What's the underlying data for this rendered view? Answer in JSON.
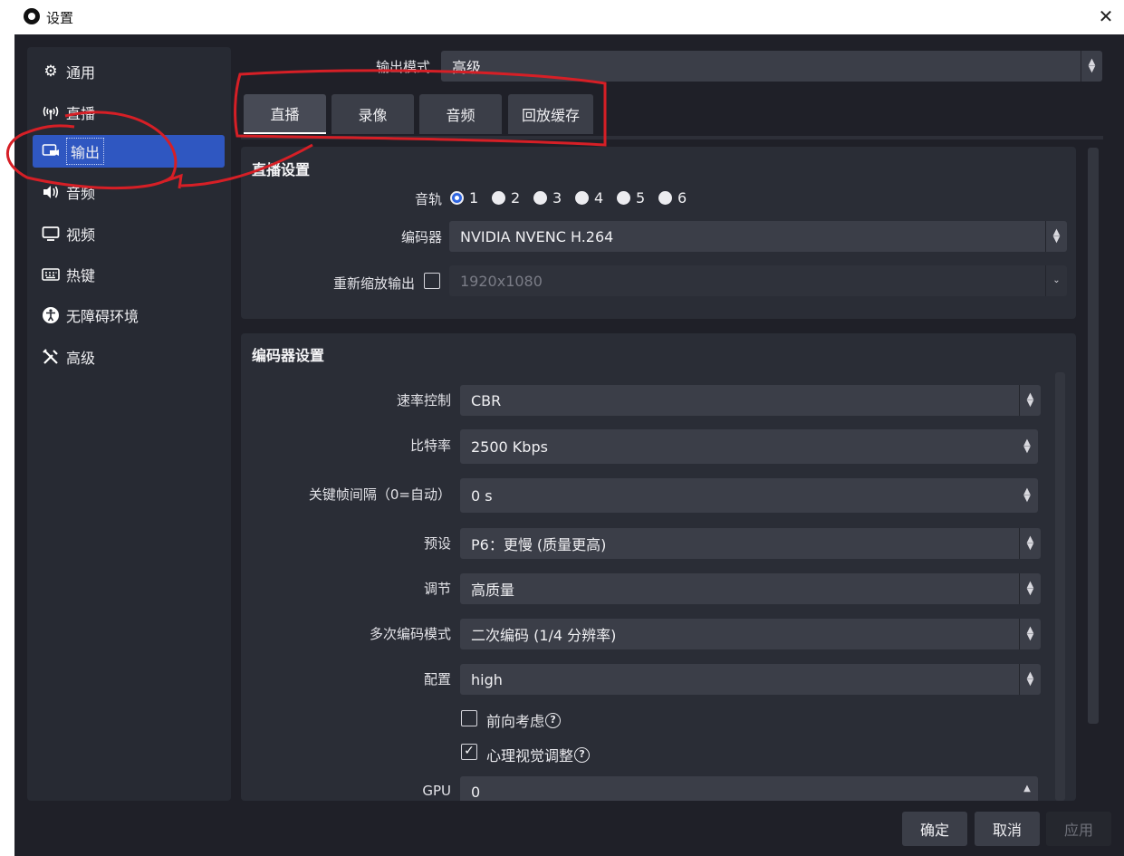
{
  "window": {
    "title": "设置",
    "close_glyph": "✕"
  },
  "sidebar": {
    "items": [
      {
        "label": "通用",
        "icon": "gear-icon"
      },
      {
        "label": "直播",
        "icon": "antenna-icon"
      },
      {
        "label": "输出",
        "icon": "output-icon",
        "active": true
      },
      {
        "label": "音频",
        "icon": "speaker-icon"
      },
      {
        "label": "视频",
        "icon": "monitor-icon"
      },
      {
        "label": "热键",
        "icon": "keyboard-icon"
      },
      {
        "label": "无障碍环境",
        "icon": "accessibility-icon"
      },
      {
        "label": "高级",
        "icon": "tools-icon"
      }
    ]
  },
  "output_mode": {
    "label": "输出模式",
    "value": "高级"
  },
  "tabs": [
    {
      "label": "直播",
      "active": true
    },
    {
      "label": "录像"
    },
    {
      "label": "音频"
    },
    {
      "label": "回放缓存"
    }
  ],
  "stream_settings": {
    "title": "直播设置",
    "track_label": "音轨",
    "tracks": [
      "1",
      "2",
      "3",
      "4",
      "5",
      "6"
    ],
    "selected_track": "1",
    "encoder_label": "编码器",
    "encoder_value": "NVIDIA NVENC H.264",
    "rescale_label": "重新缩放输出",
    "rescale_checked": false,
    "rescale_value": "1920x1080"
  },
  "encoder_settings": {
    "title": "编码器设置",
    "rate_control_label": "速率控制",
    "rate_control_value": "CBR",
    "bitrate_label": "比特率",
    "bitrate_value": "2500 Kbps",
    "keyframe_label": "关键帧间隔（0=自动）",
    "keyframe_value": "0 s",
    "preset_label": "预设",
    "preset_value": "P6：更慢 (质量更高)",
    "tuning_label": "调节",
    "tuning_value": "高质量",
    "multipass_label": "多次编码模式",
    "multipass_value": "二次编码 (1/4 分辨率)",
    "profile_label": "配置",
    "profile_value": "high",
    "lookahead_label": "前向考虑",
    "lookahead_checked": false,
    "psycho_label": "心理视觉调整",
    "psycho_checked": true,
    "gpu_label": "GPU",
    "gpu_value": "0",
    "help_glyph": "?"
  },
  "buttons": {
    "ok": "确定",
    "cancel": "取消",
    "apply": "应用"
  },
  "colors": {
    "annotation": "#d61f26",
    "accent": "#2f57c1"
  }
}
